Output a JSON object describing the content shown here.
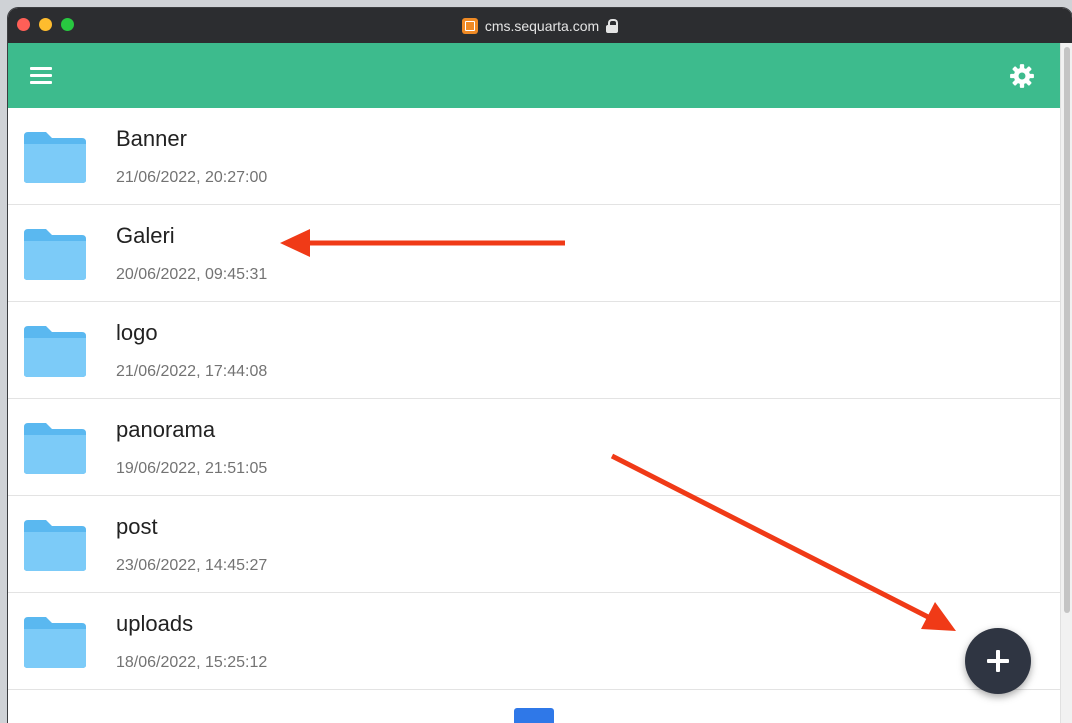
{
  "browser": {
    "url": "cms.sequarta.com"
  },
  "app": {
    "header_color": "#3dbb8d",
    "folder_color": "#6ec6f7"
  },
  "folders": [
    {
      "name": "Banner",
      "date": "21/06/2022, 20:27:00"
    },
    {
      "name": "Galeri",
      "date": "20/06/2022, 09:45:31"
    },
    {
      "name": "logo",
      "date": "21/06/2022, 17:44:08"
    },
    {
      "name": "panorama",
      "date": "19/06/2022, 21:51:05"
    },
    {
      "name": "post",
      "date": "23/06/2022, 14:45:27"
    },
    {
      "name": "uploads",
      "date": "18/06/2022, 15:25:12"
    }
  ],
  "icons": {
    "menu": "hamburger-menu-icon",
    "settings": "gear-icon",
    "folder": "folder-icon",
    "add": "plus-icon",
    "lock": "lock-icon"
  },
  "annotations": {
    "arrow_color": "#f03a17"
  }
}
